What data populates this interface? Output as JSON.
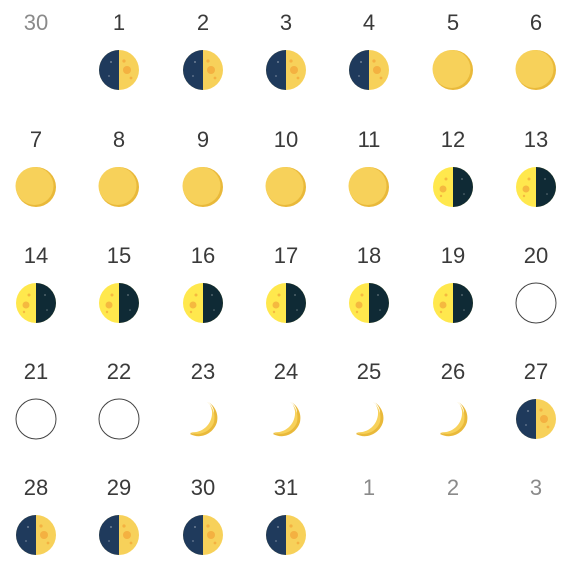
{
  "calendar": {
    "days": [
      {
        "label": "30",
        "other_month": true,
        "phase": "none"
      },
      {
        "label": "1",
        "other_month": false,
        "phase": "first-quarter"
      },
      {
        "label": "2",
        "other_month": false,
        "phase": "first-quarter"
      },
      {
        "label": "3",
        "other_month": false,
        "phase": "first-quarter"
      },
      {
        "label": "4",
        "other_month": false,
        "phase": "first-quarter"
      },
      {
        "label": "5",
        "other_month": false,
        "phase": "full"
      },
      {
        "label": "6",
        "other_month": false,
        "phase": "full"
      },
      {
        "label": "7",
        "other_month": false,
        "phase": "full"
      },
      {
        "label": "8",
        "other_month": false,
        "phase": "full"
      },
      {
        "label": "9",
        "other_month": false,
        "phase": "full"
      },
      {
        "label": "10",
        "other_month": false,
        "phase": "full"
      },
      {
        "label": "11",
        "other_month": false,
        "phase": "full"
      },
      {
        "label": "12",
        "other_month": false,
        "phase": "last-quarter"
      },
      {
        "label": "13",
        "other_month": false,
        "phase": "last-quarter"
      },
      {
        "label": "14",
        "other_month": false,
        "phase": "last-quarter"
      },
      {
        "label": "15",
        "other_month": false,
        "phase": "last-quarter"
      },
      {
        "label": "16",
        "other_month": false,
        "phase": "last-quarter"
      },
      {
        "label": "17",
        "other_month": false,
        "phase": "last-quarter"
      },
      {
        "label": "18",
        "other_month": false,
        "phase": "last-quarter"
      },
      {
        "label": "19",
        "other_month": false,
        "phase": "last-quarter"
      },
      {
        "label": "20",
        "other_month": false,
        "phase": "new"
      },
      {
        "label": "21",
        "other_month": false,
        "phase": "new"
      },
      {
        "label": "22",
        "other_month": false,
        "phase": "new"
      },
      {
        "label": "23",
        "other_month": false,
        "phase": "crescent"
      },
      {
        "label": "24",
        "other_month": false,
        "phase": "crescent"
      },
      {
        "label": "25",
        "other_month": false,
        "phase": "crescent"
      },
      {
        "label": "26",
        "other_month": false,
        "phase": "crescent"
      },
      {
        "label": "27",
        "other_month": false,
        "phase": "first-quarter"
      },
      {
        "label": "28",
        "other_month": false,
        "phase": "first-quarter"
      },
      {
        "label": "29",
        "other_month": false,
        "phase": "first-quarter"
      },
      {
        "label": "30",
        "other_month": false,
        "phase": "first-quarter"
      },
      {
        "label": "31",
        "other_month": false,
        "phase": "first-quarter"
      },
      {
        "label": "1",
        "other_month": true,
        "phase": "none"
      },
      {
        "label": "2",
        "other_month": true,
        "phase": "none"
      },
      {
        "label": "3",
        "other_month": true,
        "phase": "none"
      }
    ],
    "colors": {
      "moon_yellow": "#f7d15a",
      "moon_yellow_shade": "#e9b93a",
      "moon_bright": "#ffe84d",
      "moon_dark": "#1f3a5c",
      "moon_dark_deep": "#0f2a35",
      "crater": "#f2a93b",
      "new_moon_outline": "#444444"
    },
    "icons": {
      "first-quarter": "first-quarter-moon-icon",
      "last-quarter": "last-quarter-moon-icon",
      "full": "full-moon-icon",
      "new": "new-moon-icon",
      "crescent": "crescent-moon-icon"
    }
  }
}
